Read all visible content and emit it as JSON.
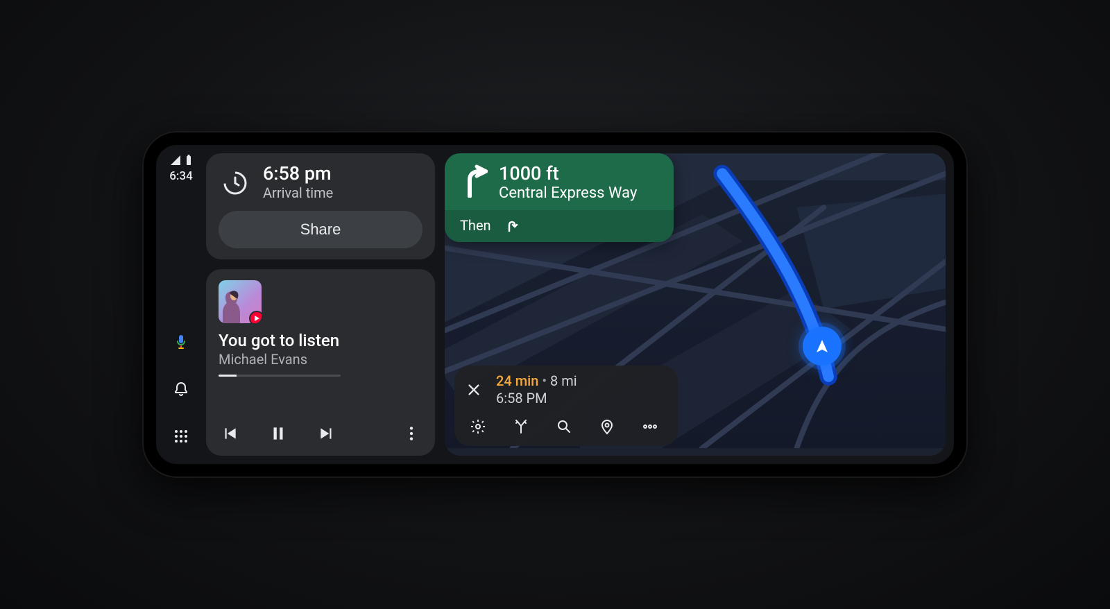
{
  "status": {
    "time": "6:34"
  },
  "arrival": {
    "time": "6:58 pm",
    "label": "Arrival time",
    "share_label": "Share"
  },
  "media": {
    "title": "You got to listen",
    "artist": "Michael Evans"
  },
  "navigation": {
    "distance": "1000 ft",
    "road": "Central Express Way",
    "then_label": "Then"
  },
  "trip": {
    "eta_minutes": "24 min",
    "separator": "•",
    "distance": "8 mi",
    "eta_clock": "6:58 PM"
  }
}
